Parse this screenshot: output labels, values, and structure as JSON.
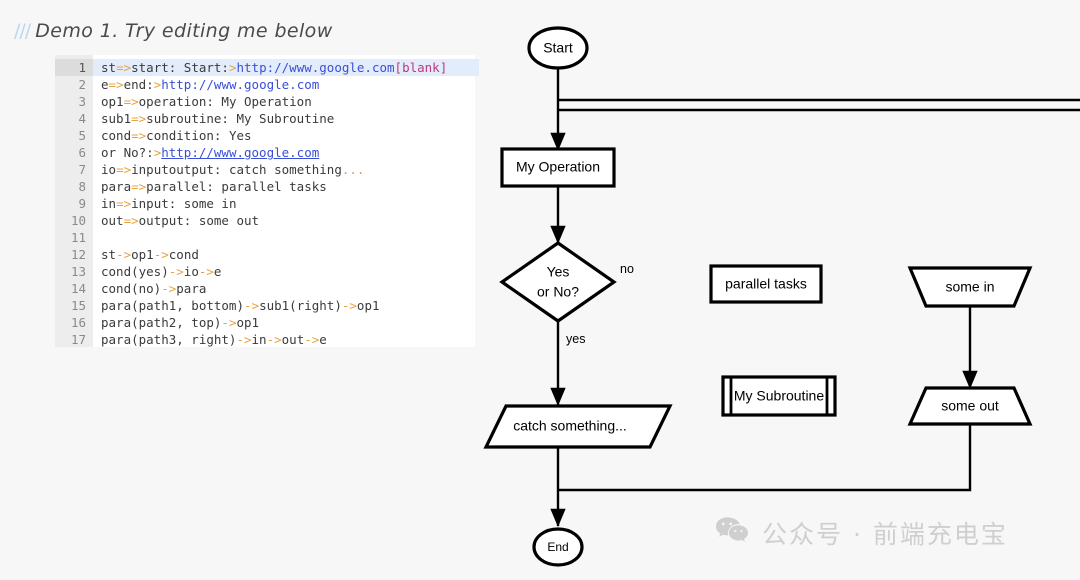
{
  "page": {
    "background": "#f7f7f7",
    "heading_prefix": "///",
    "heading": "Demo 1. Try editing me below"
  },
  "editor": {
    "active_line": 1,
    "line_numbers": [
      "1",
      "2",
      "3",
      "4",
      "5",
      "6",
      "7",
      "8",
      "9",
      "10",
      "11",
      "12",
      "13",
      "14",
      "15",
      "16",
      "17"
    ],
    "lines": [
      {
        "n": 1,
        "text": "st=>start: Start:>http://www.google.com[blank]"
      },
      {
        "n": 2,
        "text": "e=>end:>http://www.google.com"
      },
      {
        "n": 3,
        "text": "op1=>operation: My Operation"
      },
      {
        "n": 4,
        "text": "sub1=>subroutine: My Subroutine"
      },
      {
        "n": 5,
        "text": "cond=>condition: Yes"
      },
      {
        "n": 6,
        "text": "or No?:>http://www.google.com"
      },
      {
        "n": 7,
        "text": "io=>inputoutput: catch something..."
      },
      {
        "n": 8,
        "text": "para=>parallel: parallel tasks"
      },
      {
        "n": 9,
        "text": "in=>input: some in"
      },
      {
        "n": 10,
        "text": "out=>output: some out"
      },
      {
        "n": 11,
        "text": ""
      },
      {
        "n": 12,
        "text": "st->op1->cond"
      },
      {
        "n": 13,
        "text": "cond(yes)->io->e"
      },
      {
        "n": 14,
        "text": "cond(no)->para"
      },
      {
        "n": 15,
        "text": "para(path1, bottom)->sub1(right)->op1"
      },
      {
        "n": 16,
        "text": "para(path2, top)->op1"
      },
      {
        "n": 17,
        "text": "para(path3, right)->in->out->e"
      }
    ],
    "colors": {
      "arrow": "#e8a33d",
      "url": "#3a4fd6",
      "bracket": "#c0397a",
      "text": "#3b3b3b",
      "gutter_bg": "#ededed",
      "active_line_bg": "#e3ecfa"
    }
  },
  "flowchart": {
    "nodes": {
      "start": "Start",
      "operation": "My Operation",
      "condition_line1": "Yes",
      "condition_line2": "or No?",
      "parallel": "parallel tasks",
      "subroutine": "My Subroutine",
      "input": "some in",
      "output": "some out",
      "inputoutput": "catch something...",
      "end": "End"
    },
    "edge_labels": {
      "no": "no",
      "yes": "yes"
    },
    "stroke_color": "#000000",
    "fill_color": "#ffffff"
  },
  "watermark": {
    "icon": "wechat-icon",
    "text": "公众号 · 前端充电宝"
  }
}
